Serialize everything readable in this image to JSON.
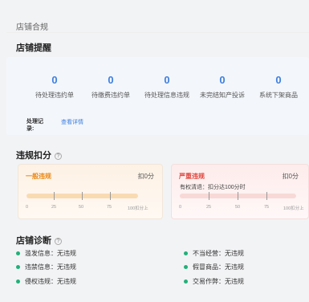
{
  "page": {
    "title": "店铺合规"
  },
  "reminder": {
    "title": "店铺提醒",
    "stats": [
      {
        "value": "0",
        "label": "待处理违约单"
      },
      {
        "value": "0",
        "label": "待缴费违约单"
      },
      {
        "value": "0",
        "label": "待处理信息违规"
      },
      {
        "value": "0",
        "label": "未完结知产投诉"
      },
      {
        "value": "0",
        "label": "系统下架商品"
      }
    ],
    "record_label": "处理记录:",
    "record_link": "查看详情"
  },
  "deduction": {
    "title": "违规扣分",
    "general": {
      "title": "一般违规",
      "score": "扣0分",
      "ticks": [
        "0",
        "25",
        "50",
        "75",
        "100扣分上"
      ]
    },
    "severe": {
      "title": "严重违规",
      "score": "扣0分",
      "note": "有权清退：扣分达100分时",
      "ticks": [
        "0",
        "25",
        "50",
        "75",
        "100扣分上"
      ]
    }
  },
  "diagnosis": {
    "title": "店铺诊断",
    "items": [
      {
        "label": "滥发信息：无违规"
      },
      {
        "label": "违禁信息：无违规"
      },
      {
        "label": "侵权违规：无违规"
      },
      {
        "label": "不当经营：无违规"
      },
      {
        "label": "假冒商品：无违规"
      },
      {
        "label": "交易作弊：无违规"
      }
    ],
    "status_color": "#21b07a"
  },
  "colors": {
    "accent": "#3d7fe0",
    "general": "#e98a18",
    "severe": "#e0463e"
  }
}
